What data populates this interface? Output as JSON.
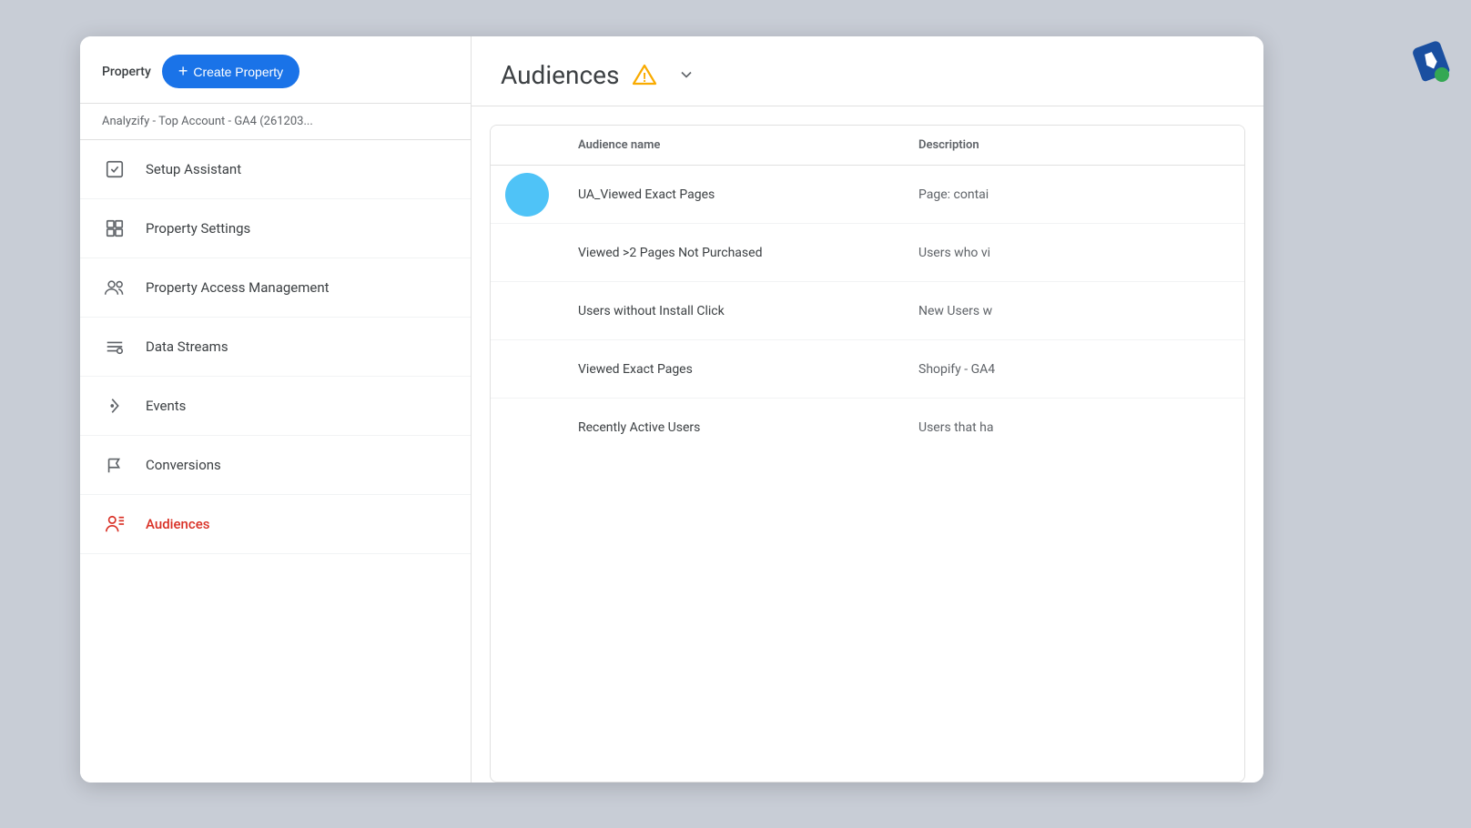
{
  "sidebar": {
    "property_label": "Property",
    "create_button_label": "Create Property",
    "account_name": "Analyzify - Top Account - GA4 (261203...",
    "nav_items": [
      {
        "id": "setup-assistant",
        "label": "Setup Assistant",
        "icon": "checkbox"
      },
      {
        "id": "property-settings",
        "label": "Property Settings",
        "icon": "property"
      },
      {
        "id": "property-access",
        "label": "Property Access Management",
        "icon": "people"
      },
      {
        "id": "data-streams",
        "label": "Data Streams",
        "icon": "streams"
      },
      {
        "id": "events",
        "label": "Events",
        "icon": "events"
      },
      {
        "id": "conversions",
        "label": "Conversions",
        "icon": "flag"
      },
      {
        "id": "audiences",
        "label": "Audiences",
        "icon": "audiences",
        "active": true
      }
    ]
  },
  "main": {
    "title": "Audiences",
    "table": {
      "columns": [
        {
          "id": "name",
          "label": "Audience name"
        },
        {
          "id": "description",
          "label": "Description"
        }
      ],
      "rows": [
        {
          "id": 1,
          "name": "UA_Viewed Exact Pages",
          "description": "Page: contai",
          "has_avatar": true
        },
        {
          "id": 2,
          "name": "Viewed >2 Pages Not Purchased",
          "description": "Users who vi",
          "has_avatar": false
        },
        {
          "id": 3,
          "name": "Users without Install Click",
          "description": "New Users w",
          "has_avatar": false
        },
        {
          "id": 4,
          "name": "Viewed Exact Pages",
          "description": "Shopify - GA4",
          "has_avatar": false
        },
        {
          "id": 5,
          "name": "Recently Active Users",
          "description": "Users that ha",
          "has_avatar": false
        }
      ]
    }
  },
  "icons": {
    "checkbox_unicode": "☑",
    "property_unicode": "▣",
    "people_unicode": "👥",
    "streams_unicode": "≡",
    "events_unicode": "☞",
    "flag_unicode": "⚑",
    "audiences_unicode": "👤",
    "plus_unicode": "+",
    "chevron_down_unicode": "▾",
    "warning_unicode": "⚠"
  }
}
